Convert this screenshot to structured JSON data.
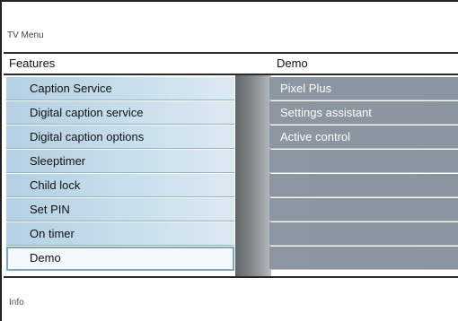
{
  "menu_title": "TV Menu",
  "columns": {
    "left": "Features",
    "right": "Demo"
  },
  "left_items": [
    {
      "label": "Caption Service"
    },
    {
      "label": "Digital caption service"
    },
    {
      "label": "Digital caption options"
    },
    {
      "label": "Sleeptimer"
    },
    {
      "label": "Child lock"
    },
    {
      "label": "Set PIN"
    },
    {
      "label": "On timer"
    },
    {
      "label": "Demo",
      "selected": true
    }
  ],
  "right_items": [
    {
      "label": "Pixel Plus"
    },
    {
      "label": "Settings assistant"
    },
    {
      "label": "Active control"
    },
    {
      "label": ""
    },
    {
      "label": ""
    },
    {
      "label": ""
    },
    {
      "label": ""
    },
    {
      "label": ""
    }
  ],
  "footer": {
    "info": "Info"
  }
}
